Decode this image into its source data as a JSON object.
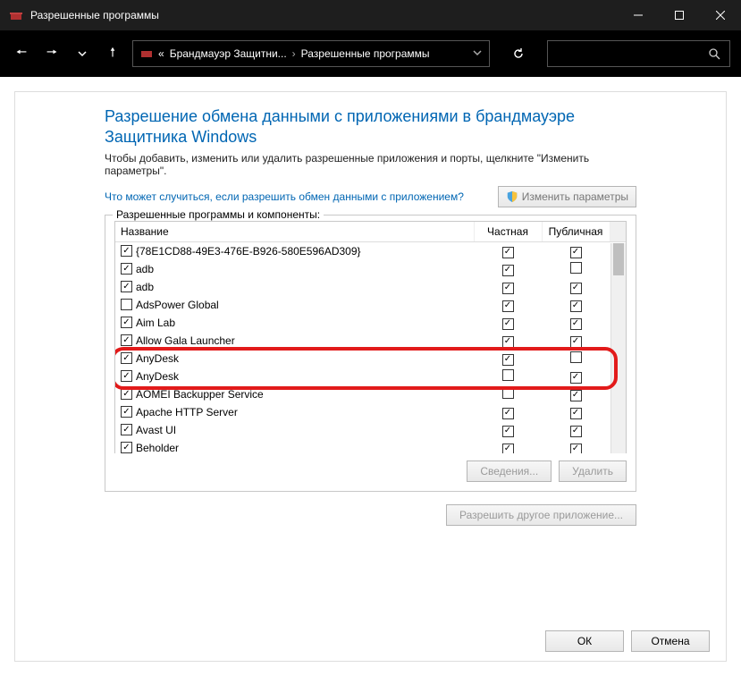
{
  "window": {
    "title": "Разрешенные программы"
  },
  "breadcrumb": {
    "first_prefix": "«",
    "first": "Брандмауэр Защитни...",
    "second": "Разрешенные программы"
  },
  "heading": "Разрешение обмена данными с приложениями в брандмауэре Защитника Windows",
  "subtitle": "Чтобы добавить, изменить или удалить разрешенные приложения и порты, щелкните \"Изменить параметры\".",
  "risk_link": "Что может случиться, если разрешить обмен данными с приложением?",
  "change_params_label": "Изменить параметры",
  "group_label": "Разрешенные программы и компоненты:",
  "columns": {
    "name": "Название",
    "private": "Частная",
    "public": "Публичная"
  },
  "rows": [
    {
      "enabled": true,
      "name": "{78E1CD88-49E3-476E-B926-580E596AD309}",
      "private": true,
      "public": true
    },
    {
      "enabled": true,
      "name": "adb",
      "private": true,
      "public": false
    },
    {
      "enabled": true,
      "name": "adb",
      "private": true,
      "public": true
    },
    {
      "enabled": false,
      "name": "AdsPower Global",
      "private": true,
      "public": true
    },
    {
      "enabled": true,
      "name": "Aim Lab",
      "private": true,
      "public": true
    },
    {
      "enabled": true,
      "name": "Allow Gala Launcher",
      "private": true,
      "public": true
    },
    {
      "enabled": true,
      "name": "AnyDesk",
      "private": true,
      "public": false
    },
    {
      "enabled": true,
      "name": "AnyDesk",
      "private": false,
      "public": true
    },
    {
      "enabled": true,
      "name": "AOMEI Backupper Service",
      "private": false,
      "public": true
    },
    {
      "enabled": true,
      "name": "Apache HTTP Server",
      "private": true,
      "public": true
    },
    {
      "enabled": true,
      "name": "Avast UI",
      "private": true,
      "public": true
    },
    {
      "enabled": true,
      "name": "Beholder",
      "private": true,
      "public": true
    }
  ],
  "buttons": {
    "details": "Сведения...",
    "delete": "Удалить",
    "allow_another": "Разрешить другое приложение...",
    "ok": "ОК",
    "cancel": "Отмена"
  },
  "highlight_row_indices": [
    6,
    7
  ]
}
